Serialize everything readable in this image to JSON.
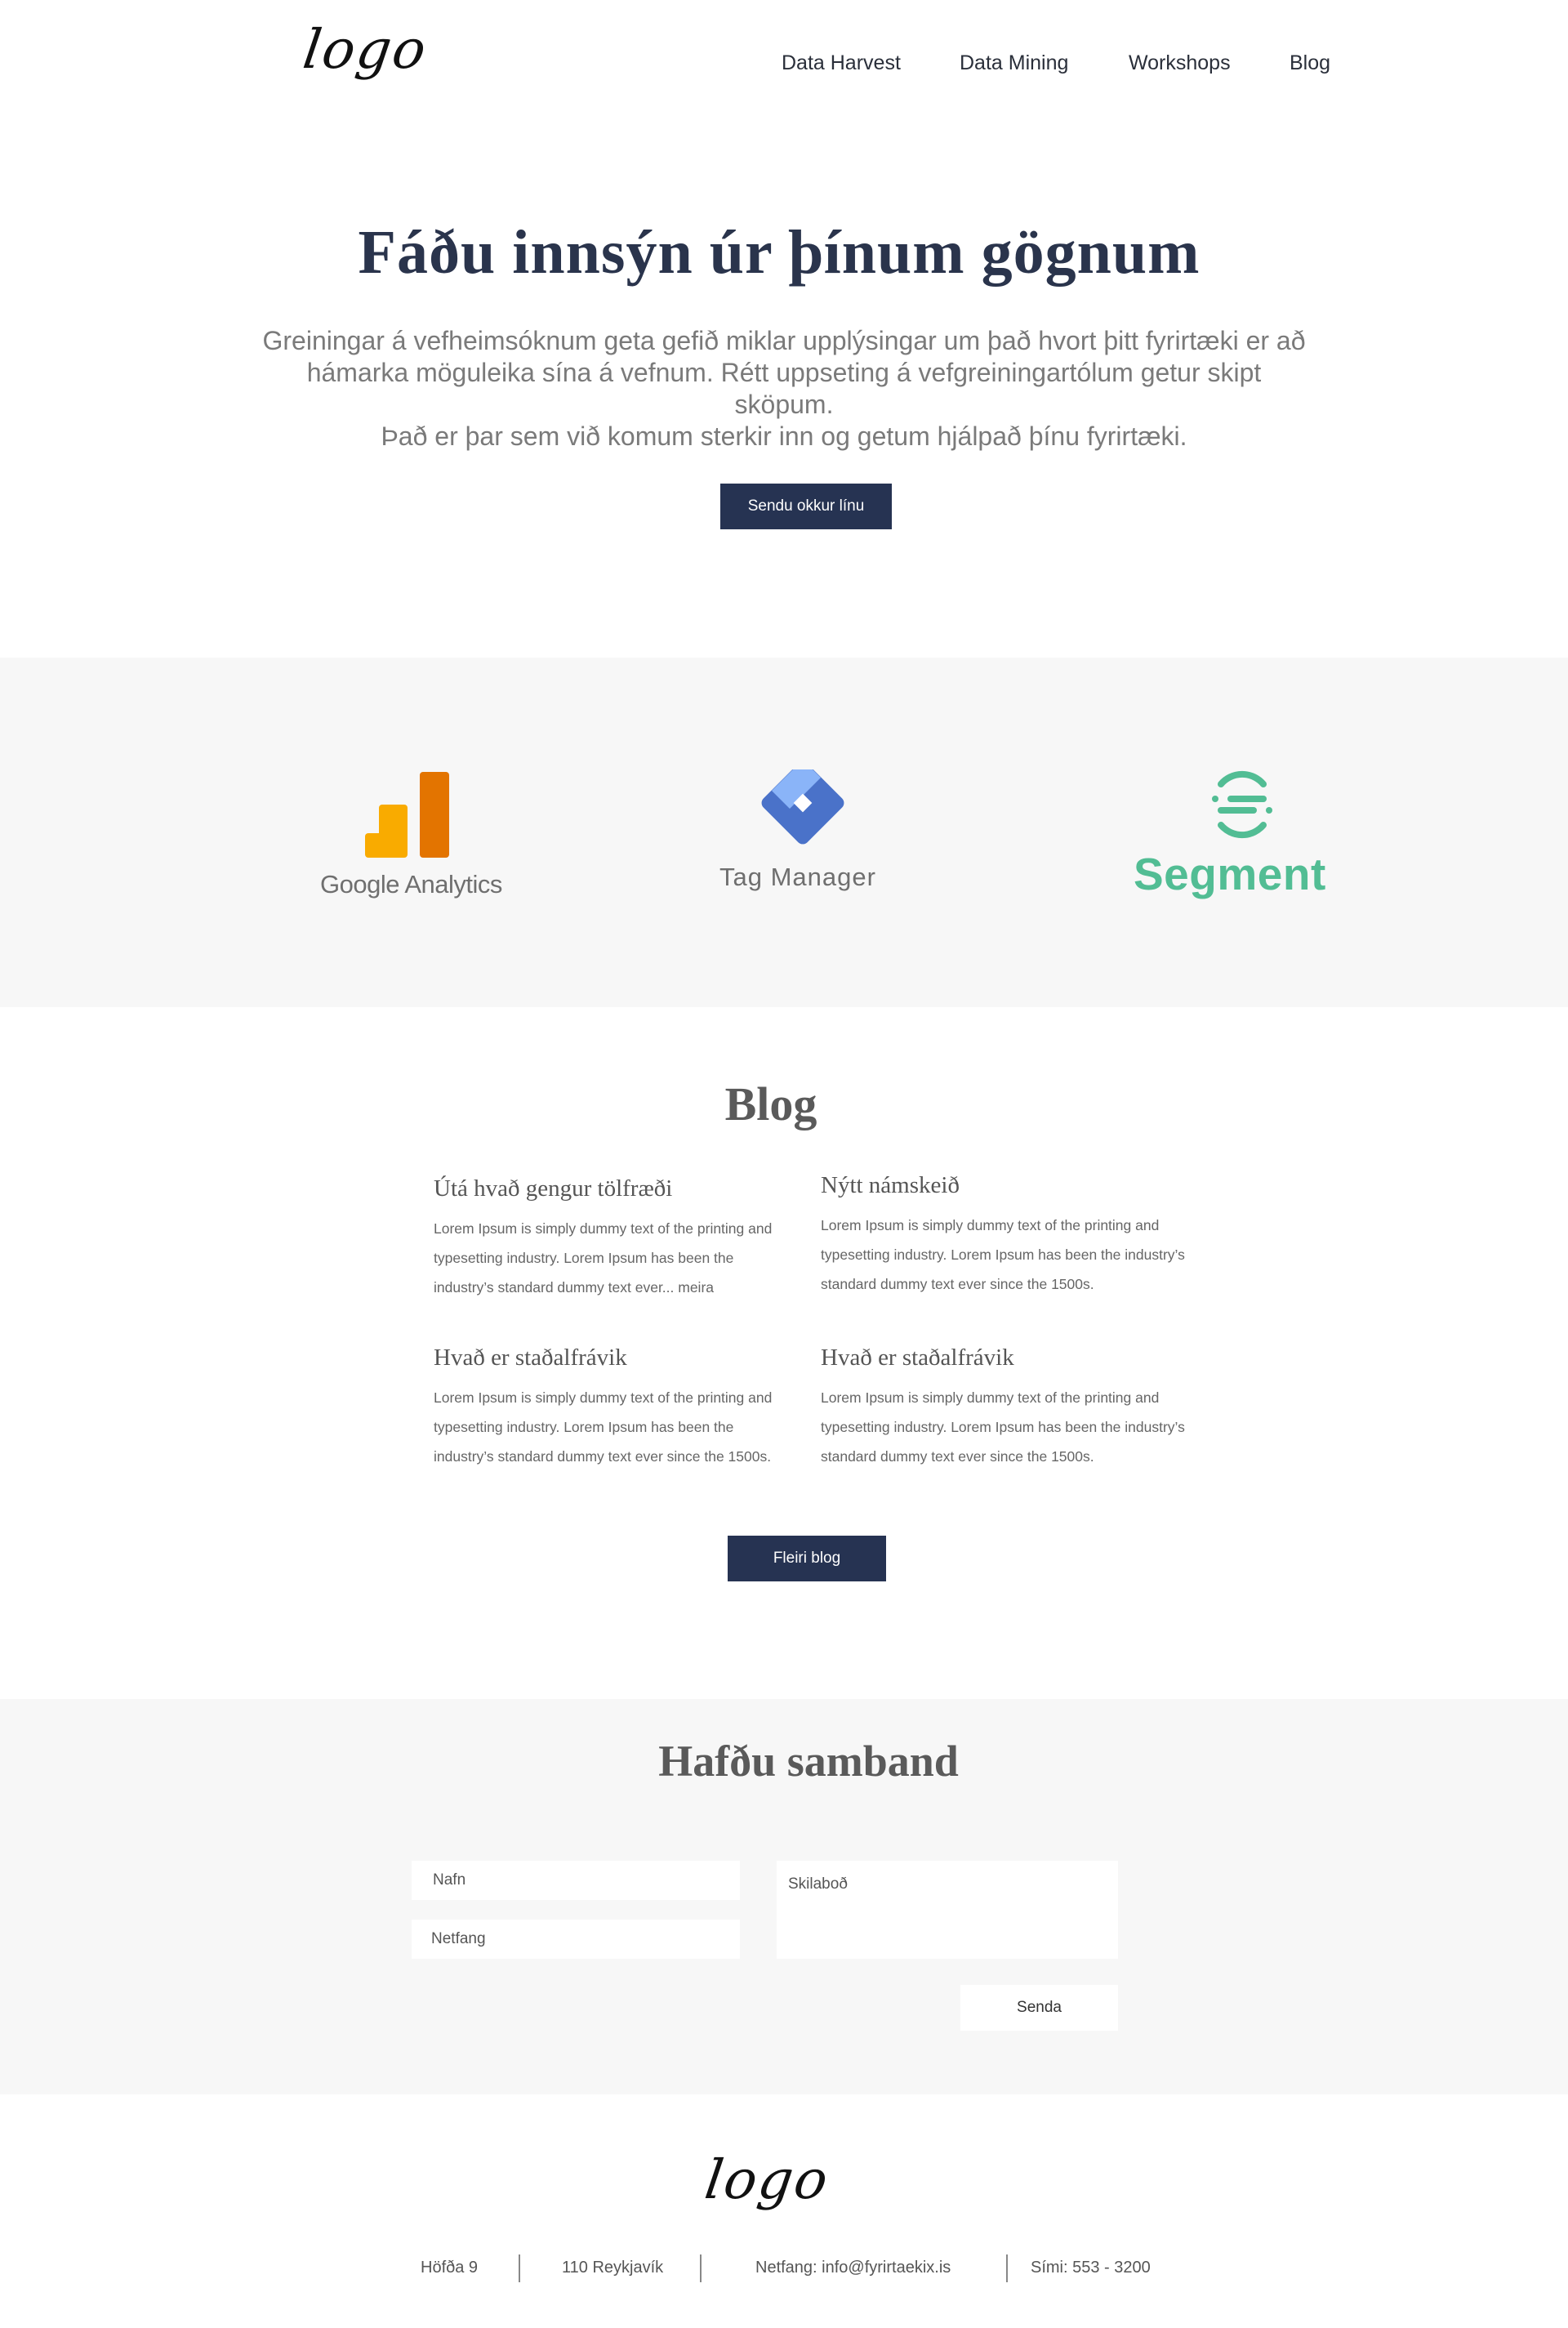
{
  "header": {
    "logo": "logo",
    "nav": [
      "Data Harvest",
      "Data Mining",
      "Workshops",
      "Blog"
    ]
  },
  "hero": {
    "title": "Fáðu innsýn úr þínum gögnum",
    "subtitle_lines": [
      "Greiningar á vefheimsóknum geta gefið miklar upplýsingar um það hvort þitt fyrirtæki er að",
      "hámarka möguleika sína á vefnum. Rétt uppseting á vefgreiningartólum getur skipt sköpum.",
      "Það er þar sem við komum sterkir inn og getum hjálpað þínu fyrirtæki."
    ],
    "cta": "Sendu okkur línu"
  },
  "partners": {
    "google_analytics": "Google Analytics",
    "tag_manager": "Tag Manager",
    "segment": "Segment",
    "colors": {
      "ga_yellow": "#F9AB00",
      "ga_orange": "#E37400",
      "gtm_light": "#8AB4F8",
      "gtm_dark": "#4285F4",
      "segment_green": "#52BD94"
    }
  },
  "blog": {
    "title": "Blog",
    "posts": [
      {
        "title": "Útá hvað gengur tölfræði",
        "lines": [
          "Lorem Ipsum is simply dummy text of the printing and",
          "typesetting industry. Lorem Ipsum has been the",
          "industry’s standard dummy text ever... meira"
        ]
      },
      {
        "title": "Nýtt námskeið",
        "lines": [
          "Lorem Ipsum is simply dummy text of the printing and",
          "typesetting industry. Lorem Ipsum has been the industry’s",
          "standard dummy text ever since the 1500s."
        ]
      },
      {
        "title": "Hvað er staðalfrávik",
        "lines": [
          "Lorem Ipsum is simply dummy text of the printing and",
          "typesetting industry. Lorem Ipsum has been the",
          "industry’s standard dummy text ever since the 1500s."
        ]
      },
      {
        "title": "Hvað er staðalfrávik",
        "lines": [
          "Lorem Ipsum is simply dummy text of the printing and",
          "typesetting industry. Lorem Ipsum has been the industry’s",
          "standard dummy text ever since the 1500s."
        ]
      }
    ],
    "more_button": "Fleiri blog"
  },
  "contact": {
    "title": "Hafðu samband",
    "name_placeholder": "Nafn",
    "email_placeholder": "Netfang",
    "message_placeholder": "Skilaboð",
    "submit": "Senda"
  },
  "footer": {
    "logo": "logo",
    "address": "Höfða 9",
    "city": "110 Reykjavík",
    "email": "Netfang: info@fyrirtaekix.is",
    "phone": "Sími: 553 - 3200"
  }
}
